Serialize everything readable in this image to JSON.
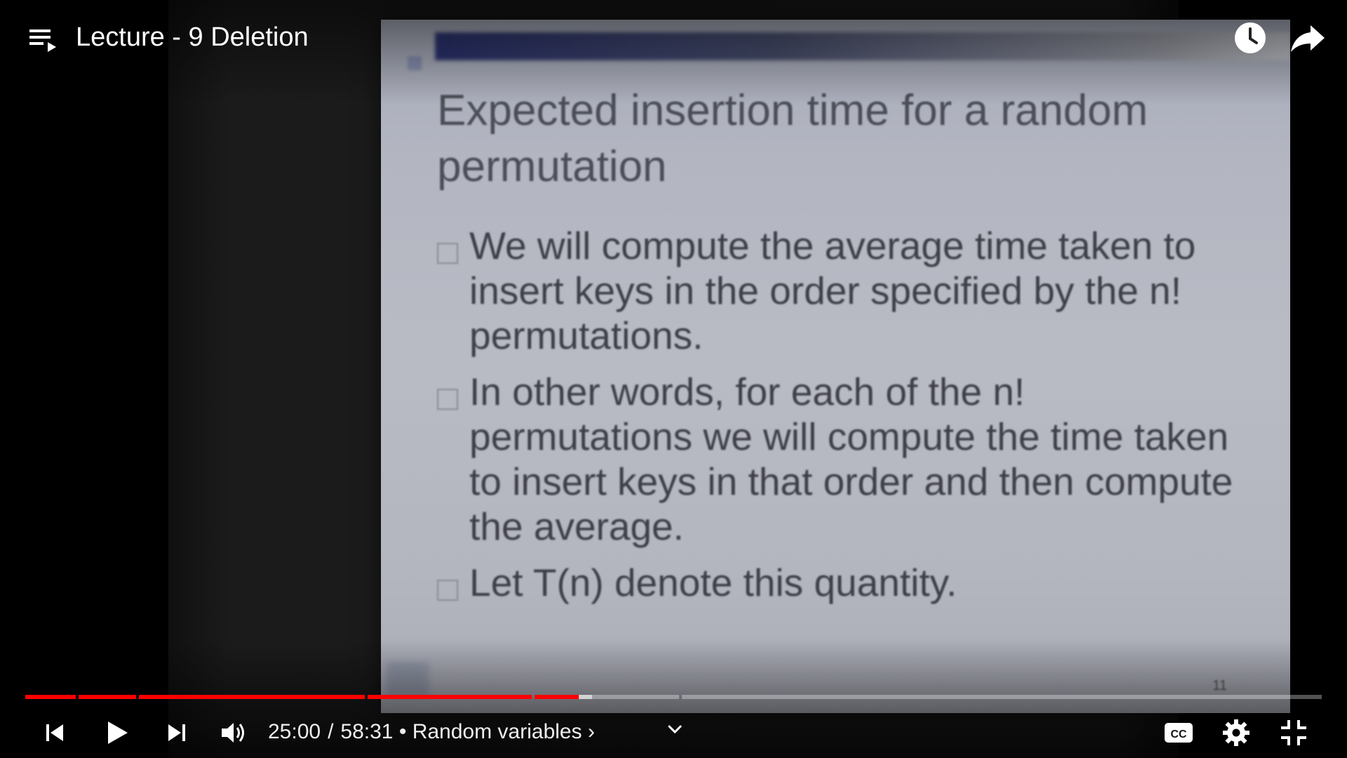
{
  "player": {
    "title": "Lecture - 9 Deletion",
    "time_current": "25:00",
    "time_separator": "/",
    "time_duration": "58:31",
    "chapter_prefix": "•",
    "chapter": "Random variables",
    "chapter_arrow": "›",
    "progress_fraction": 0.427,
    "buffered_fraction": 0.437
  },
  "slide": {
    "title": "Expected insertion time for a random permutation",
    "bullets": [
      "We will compute the average time taken to insert keys in the order specified by the n! permutations.",
      "In other words, for each of the n! permutations we will compute the time taken to insert keys in that order and then compute the average.",
      "Let T(n) denote this quantity."
    ],
    "page_number": "11"
  },
  "icons": {
    "playlist": "playlist-icon",
    "watch_later": "clock-icon",
    "share": "share-arrow-icon",
    "previous": "skip-previous-icon",
    "play": "play-icon",
    "next": "skip-next-icon",
    "volume": "volume-icon",
    "chapter_menu": "chevron-down-icon",
    "captions": "cc-icon",
    "settings": "gear-icon",
    "exit_fullscreen": "exit-fullscreen-icon"
  },
  "colors": {
    "progress_played": "#ff0000",
    "progress_track": "#5a5a5a"
  }
}
